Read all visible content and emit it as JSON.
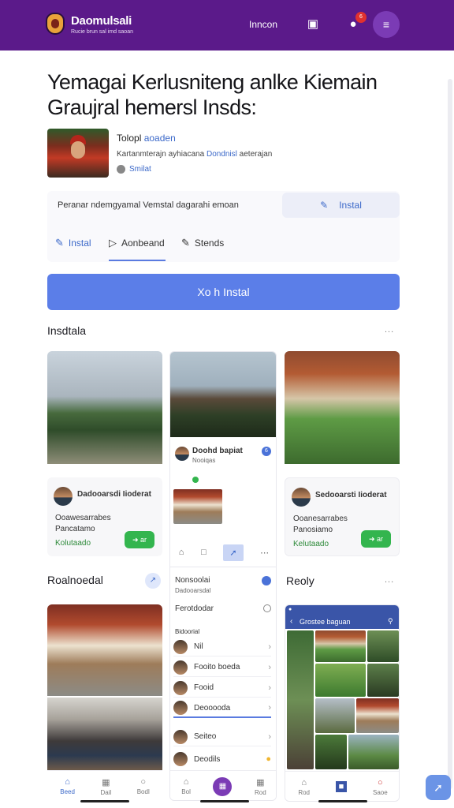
{
  "topbar": {
    "brand": "Daomulsali",
    "brand_sub": "Rucie brun sal imd saoan",
    "nav_link": "Inncon",
    "scan_icon": "scan-icon",
    "notif_count": "6",
    "menu_icon": "menu-icon"
  },
  "hero": {
    "title": "Yemagai Kerlusniteng anlke Kiemain Graujral hemersl Insds:"
  },
  "author": {
    "name_prefix": "Tolopl",
    "name_link": "aoaden",
    "desc": "Kartanmterajn ayhiacana",
    "desc_link": "Dondnisl",
    "desc_suffix": "aeterajan",
    "tag": "Smilat"
  },
  "panel": {
    "text": "Peranar ndemgyamal Vemstal dagarahi emoan",
    "install_button": "Instal",
    "tabs": [
      {
        "label": "Instal",
        "icon": "pencil-icon"
      },
      {
        "label": "Aonbeand",
        "icon": "play-icon"
      },
      {
        "label": "Stends",
        "icon": "pencil-icon"
      }
    ]
  },
  "cta": {
    "label": "Xo h Instal"
  },
  "sections": {
    "first": "Insdtala",
    "second_left": "Roalnoedal",
    "second_right": "Reoly",
    "more": "..."
  },
  "cards": {
    "left": {
      "author": "Dadooarsdi Iioderat",
      "line1": "Ooawesarrabes",
      "line2": "Pancatamo",
      "status": "Kolutaado",
      "button": "ar"
    },
    "middle": {
      "title": "Doohd bapiat",
      "sub": "Nooiqas",
      "badge": "6",
      "post_title": "Nonsoolai",
      "post_sub": "Dadooarsdal",
      "post_line": "Ferotdodar",
      "post_foot": "Bidoorial",
      "list": [
        "Nil",
        "Fooito boeda",
        "Fooid",
        "Deooooda",
        "Seiteo",
        "Deodils"
      ]
    },
    "right": {
      "author": "Sedooarsti Iioderat",
      "line1": "Ooanesarrabes",
      "line2": "Panosiamo",
      "status": "Kelutaado",
      "button": "ar",
      "phone_title": "Grostee baguan"
    }
  },
  "bottomnav": {
    "left": [
      {
        "label": "Beed",
        "icon": "home-icon",
        "active": true
      },
      {
        "label": "Dail",
        "icon": "grid-icon",
        "active": false
      },
      {
        "label": "Bodl",
        "icon": "user-icon",
        "active": false
      }
    ],
    "middle": [
      {
        "label": "Bol",
        "icon": "home-icon",
        "active": false
      },
      {
        "label": "Rod",
        "icon": "grid-icon",
        "active": false
      }
    ],
    "right": [
      {
        "label": "Rod",
        "icon": "home-icon",
        "active": false
      },
      {
        "label": "",
        "icon": "square-icon",
        "active": true
      },
      {
        "label": "Saoe",
        "icon": "user-icon",
        "active": false
      }
    ]
  },
  "colors": {
    "topbar": "#5b1a8a",
    "accent": "#5b7ee8",
    "link": "#3c69c9",
    "success": "#33b54e"
  }
}
